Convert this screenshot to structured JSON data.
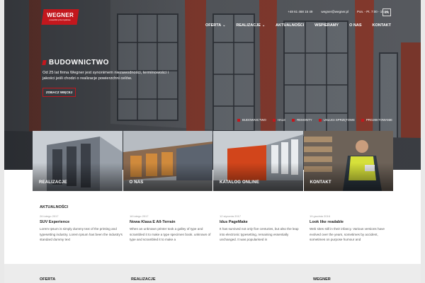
{
  "brand": {
    "name": "WEGNER",
    "tagline": "posadzki przemysłowe"
  },
  "contact": {
    "phone": "+48 61 468 15 49",
    "email": "wegner@wegner.pl",
    "hours": "Pon. - Pt. 7:00 - 15:00"
  },
  "lang": "EN",
  "nav": [
    {
      "label": "OFERTA",
      "dropdown": true
    },
    {
      "label": "REALIZACJE",
      "dropdown": true
    },
    {
      "label": "AKTUALNOŚCI",
      "dropdown": false
    },
    {
      "label": "WSPIERAMY",
      "dropdown": false
    },
    {
      "label": "O NAS",
      "dropdown": false
    },
    {
      "label": "KONTAKT",
      "dropdown": false
    }
  ],
  "hero": {
    "title": "BUDOWNICTWO",
    "description": "Od 25 lat firma Wegner jest synonimem niezawodności, terminowości i jakości jeśli chodzi o realizacje powierzchni celów.",
    "button": "ZOBACZ WIĘCEJ"
  },
  "slider": [
    "BUDOWNICTWO",
    "HALE",
    "REMONTY",
    "USŁUGI SPRZĘTOWE",
    "PROJEKTOWANIE"
  ],
  "tiles": [
    "REALIZACJE",
    "O NAS",
    "KATALOG ONLINE",
    "KONTAKT"
  ],
  "news_heading": "AKTUALNOŚCI",
  "news": [
    {
      "date": "26 lutego 2017",
      "title": "SUV Experience",
      "text": "Lorem Ipsum is simply dummy text of the printing and typesetting industry. Lorem Ipsum has been the industry's standard dummy text"
    },
    {
      "date": "18 lutego 2017",
      "title": "Nowa Klasa E All-Terrain",
      "text": "When an unknown printer took a galley of type and scrambled it to make a type specimen book. unknown of type and scrambled it to make a"
    },
    {
      "date": "12 stycznia 2017",
      "title": "Idus PageMake",
      "text": "It has survived not only five centuries, but also the leap into electronic typesetting, remaining essentially unchanged. It was popularised in"
    },
    {
      "date": "19 grudnia 2016",
      "title": "Look like readable",
      "text": "Web sites still in their infancy. Various versions have evolved over the years, sometimes by accident, sometimes on purpose humour and"
    }
  ],
  "footer": [
    "OFERTA",
    "REALIZACJE",
    "WEGNER"
  ],
  "colors": {
    "accent": "#c3171d",
    "brick": "#8a3b2e",
    "footer_bg": "#ececec"
  }
}
